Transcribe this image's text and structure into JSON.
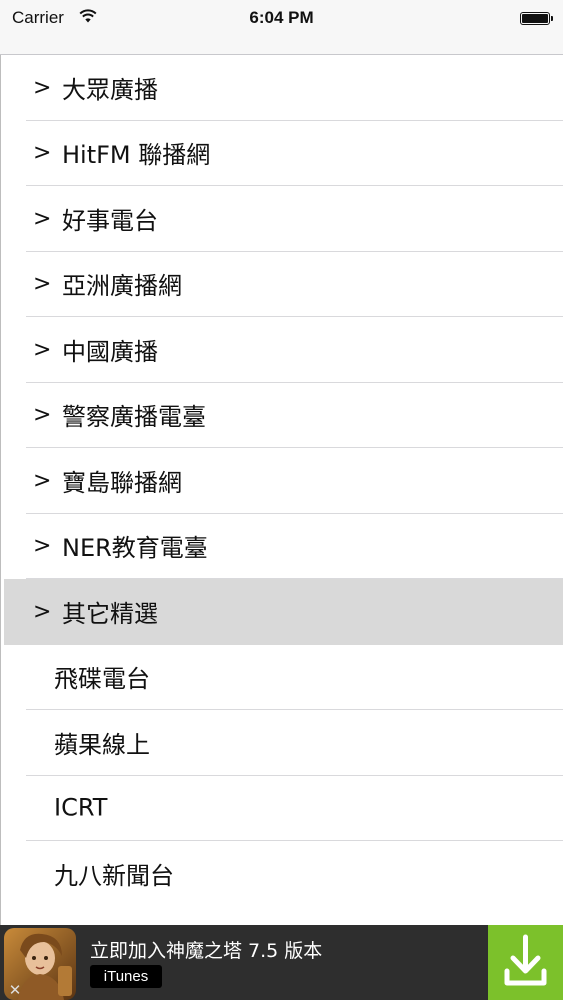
{
  "status_bar": {
    "carrier": "Carrier",
    "time": "6:04 PM",
    "wifi_icon": "wifi-icon",
    "battery_icon": "battery-icon"
  },
  "menu": {
    "chevron": ">",
    "items": [
      {
        "label": "大眾廣播",
        "has_chevron": true
      },
      {
        "label": "HitFM 聯播網",
        "has_chevron": true
      },
      {
        "label": "好事電台",
        "has_chevron": true
      },
      {
        "label": "亞洲廣播網",
        "has_chevron": true
      },
      {
        "label": "中國廣播",
        "has_chevron": true
      },
      {
        "label": "警察廣播電臺",
        "has_chevron": true
      },
      {
        "label": "寶島聯播網",
        "has_chevron": true
      },
      {
        "label": "NER教育電臺",
        "has_chevron": true
      },
      {
        "label": "其它精選",
        "has_chevron": true,
        "selected": true
      },
      {
        "label": "飛碟電台",
        "has_chevron": false
      },
      {
        "label": "蘋果線上",
        "has_chevron": false
      },
      {
        "label": "ICRT",
        "has_chevron": false
      },
      {
        "label": "九八新聞台",
        "has_chevron": false
      }
    ]
  },
  "ad": {
    "title": "立即加入神魔之塔 7.5 版本",
    "source": "iTunes",
    "close_icon": "close-icon",
    "download_icon": "download-icon",
    "accent_color": "#7cc12b"
  },
  "colors": {
    "selected_row": "#d9d9d9",
    "separator": "#d9d9dc",
    "status_bar_bg": "#f7f7f7"
  }
}
